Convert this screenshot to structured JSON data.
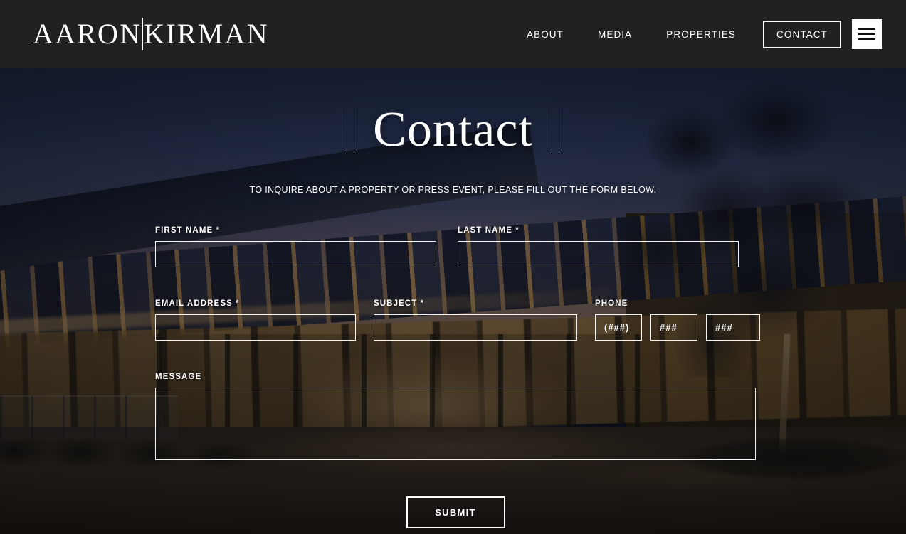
{
  "header": {
    "logo": {
      "part1": "AARON",
      "part2": "KIRMAN",
      "divider_icon": "vertical-divider-icon"
    },
    "nav": [
      {
        "label": "ABOUT",
        "name": "nav-about"
      },
      {
        "label": "MEDIA",
        "name": "nav-media"
      },
      {
        "label": "PROPERTIES",
        "name": "nav-properties"
      }
    ],
    "contact_button": "CONTACT",
    "menu_icon": "hamburger-menu-icon",
    "background_color": "#212121"
  },
  "hero": {
    "title": "Contact",
    "subtitle": "TO INQUIRE ABOUT A PROPERTY OR PRESS EVENT, PLEASE FILL OUT THE FORM BELOW.",
    "rule_icon": "double-vertical-rule-icon"
  },
  "form": {
    "fields": {
      "first_name": {
        "label": "FIRST NAME *",
        "value": "",
        "placeholder": ""
      },
      "last_name": {
        "label": "LAST NAME *",
        "value": "",
        "placeholder": ""
      },
      "email": {
        "label": "EMAIL ADDRESS *",
        "value": "",
        "placeholder": ""
      },
      "subject": {
        "label": "SUBJECT *",
        "value": "",
        "placeholder": ""
      },
      "phone": {
        "label": "PHONE",
        "area_placeholder": "(###)",
        "prefix_placeholder": "###",
        "line_placeholder": "###"
      },
      "message": {
        "label": "MESSAGE",
        "value": "",
        "placeholder": ""
      }
    },
    "submit_label": "SUBMIT"
  },
  "colors": {
    "header_bg": "#212121",
    "text": "#ffffff",
    "field_border": "#ffffff",
    "sky": "#2a3557"
  }
}
